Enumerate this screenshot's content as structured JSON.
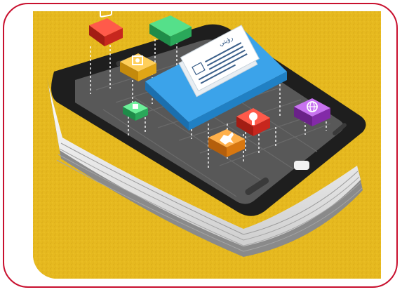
{
  "image": {
    "subject": "illustration",
    "arabic_label": "رؤيتي"
  },
  "colors": {
    "frame_border": "#c8102e",
    "background_yellow": "#e6b91f",
    "phone_black": "#1e1e1e",
    "card_blue": "#2f93d8",
    "tile_red": "#e0302a",
    "tile_green": "#3cc36a",
    "tile_yellow": "#f0b21e",
    "tile_orange": "#f08a1e",
    "tile_purple": "#9b3fc2"
  },
  "icons": [
    "tv-icon",
    "monitor-icon",
    "camera-icon",
    "document-card",
    "small-green-tile-icon",
    "microphone-icon",
    "globe-icon",
    "horse-icon"
  ]
}
